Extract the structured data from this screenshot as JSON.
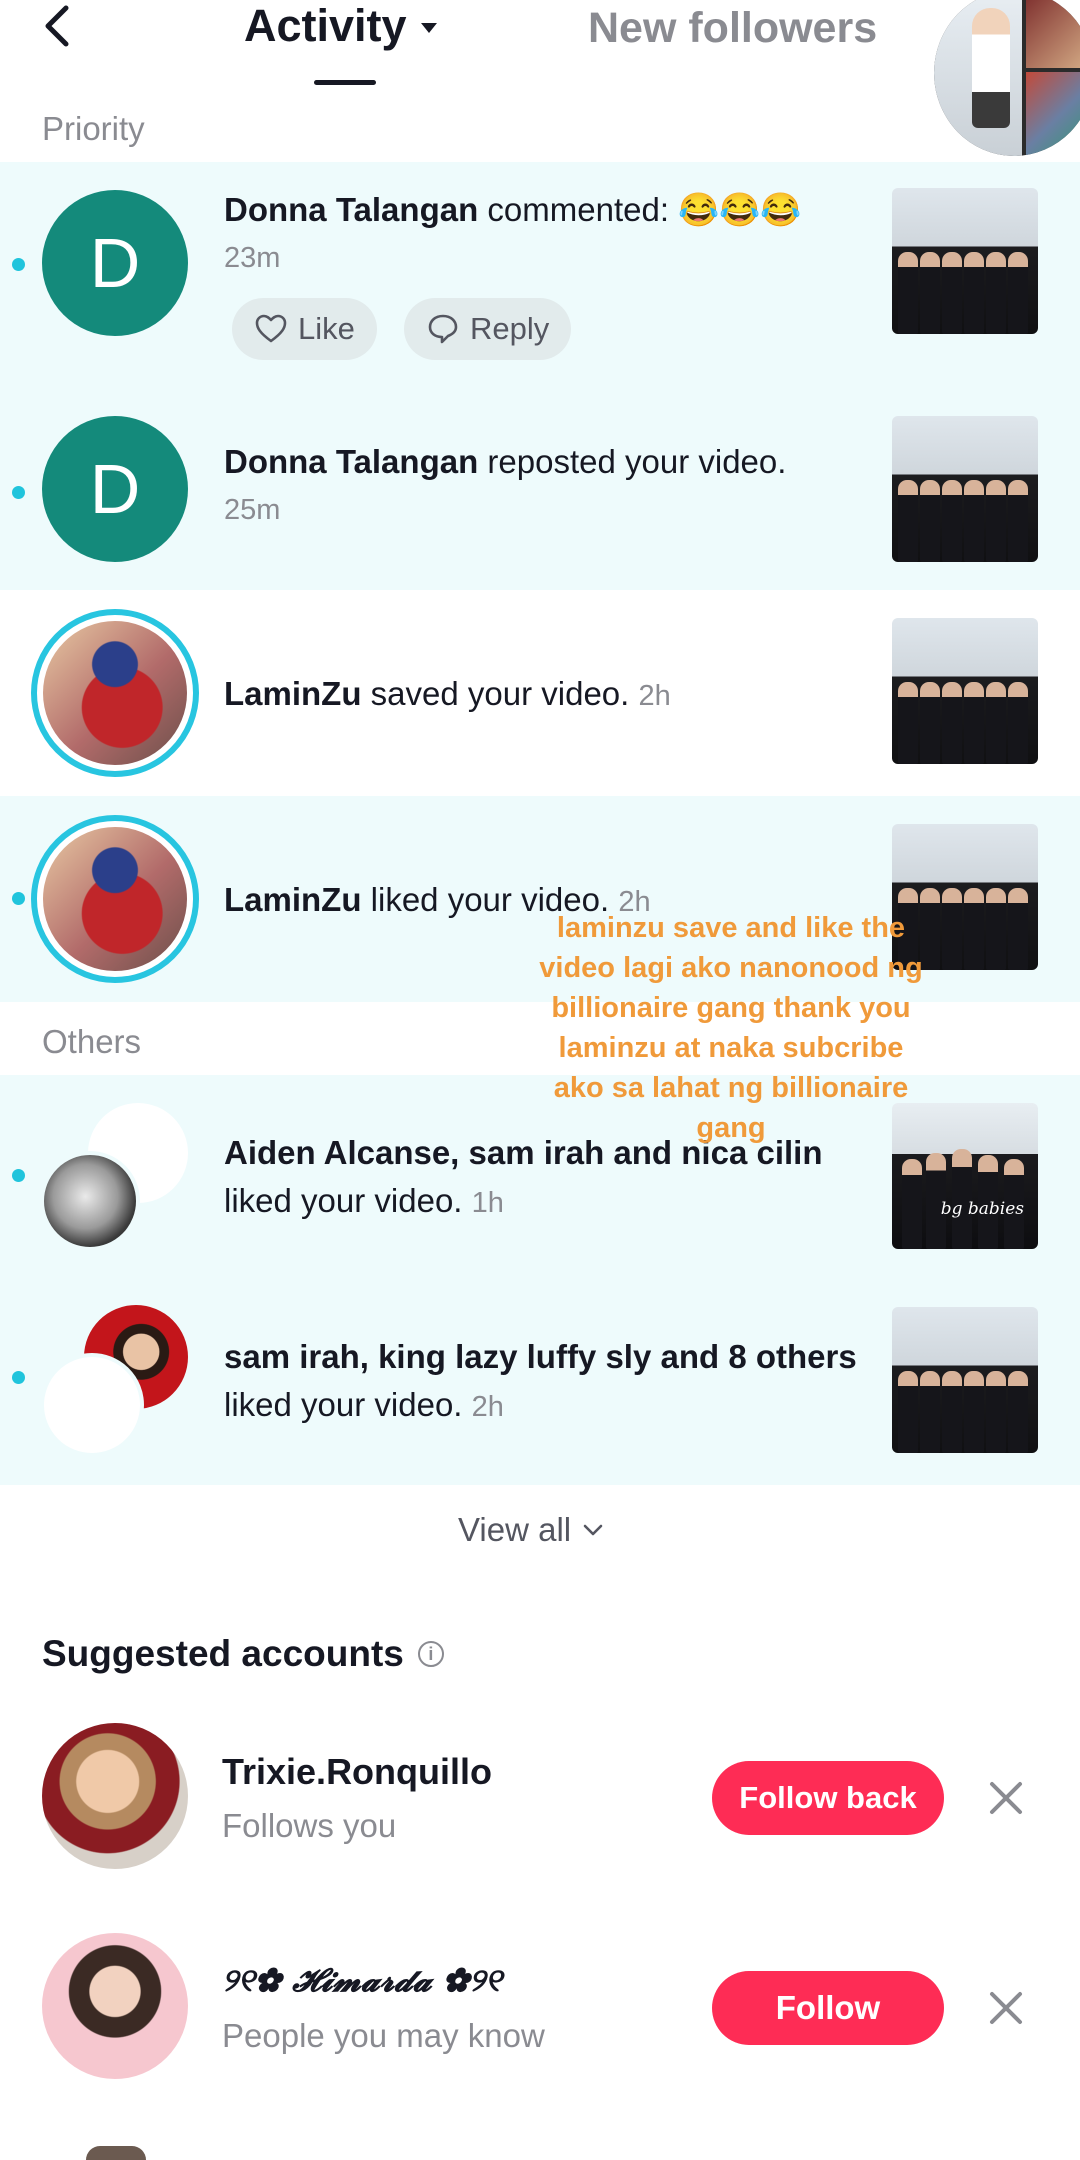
{
  "header": {
    "tab_activity": "Activity",
    "tab_new_followers": "New followers"
  },
  "sections": {
    "priority": "Priority",
    "others": "Others"
  },
  "notifications": [
    {
      "user": "Donna Talangan",
      "action": " commented: 😂😂😂",
      "time": "23m",
      "avatar_letter": "D",
      "unread": true
    },
    {
      "user": "Donna Talangan",
      "action": " reposted your video.",
      "time": "25m",
      "avatar_letter": "D",
      "unread": true
    },
    {
      "user": "LaminZu",
      "action": " saved your video.",
      "time": "2h",
      "unread": false
    },
    {
      "user": "LaminZu",
      "action": " liked your video.",
      "time": "2h",
      "unread": true
    },
    {
      "users": "Aiden Alcanse, sam irah and nica cilin",
      "action": "liked your video.",
      "time": "1h",
      "unread": true
    },
    {
      "users": "sam irah, king lazy luffy sly and 8 others",
      "action": "liked your video.",
      "time": "2h",
      "unread": true
    }
  ],
  "actions": {
    "like": "Like",
    "reply": "Reply"
  },
  "overlay_text": "laminzu save and like the video lagi ako nanonood ng billionaire gang thank you laminzu at naka subcribe ako sa lahat ng billionaire gang",
  "thumbnail_watermark": "bg babies",
  "view_all": "View all",
  "suggested": {
    "title": "Suggested accounts",
    "accounts": [
      {
        "name": "Trixie.Ronquillo",
        "subtitle": "Follows you",
        "button": "Follow back"
      },
      {
        "name": "୨୧✿ 𝓗𝓲𝓶𝓪𝓻𝓭𝓪 ✿୨୧",
        "subtitle": "People you may know",
        "button": "Follow"
      }
    ]
  },
  "colors": {
    "accent": "#fe2c55",
    "unread_dot": "#20c4dc",
    "row_tint": "#eefbfc",
    "avatar_green": "#148a7b",
    "overlay_orange": "#f09a3a"
  }
}
